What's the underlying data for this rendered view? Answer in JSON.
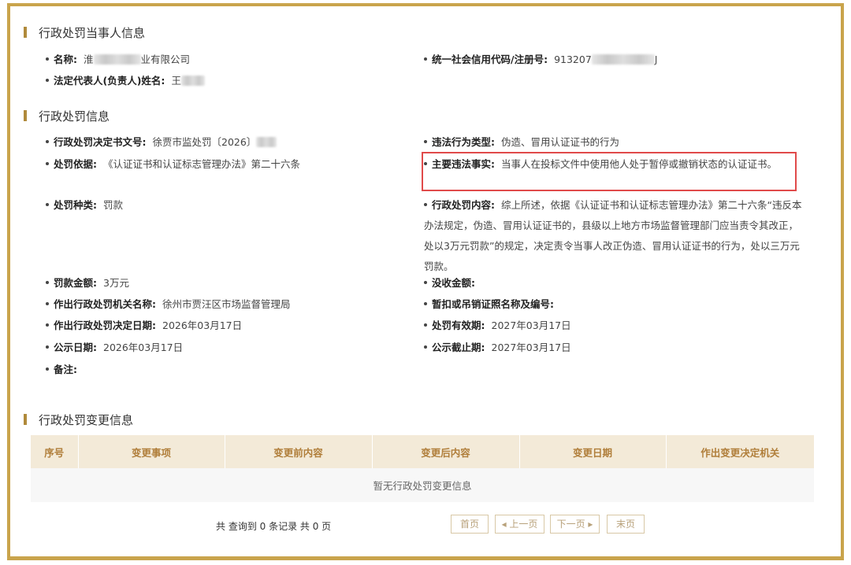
{
  "party_section": {
    "title": "行政处罚当事人信息",
    "name_label": "名称:",
    "name_value_prefix": "淮",
    "name_value_suffix": "业有限公司",
    "credit_code_label": "统一社会信用代码/注册号:",
    "credit_code_prefix": "913207",
    "credit_code_suffix": "J",
    "legal_rep_label": "法定代表人(负责人)姓名:",
    "legal_rep_prefix": "王"
  },
  "penalty_section": {
    "title": "行政处罚信息",
    "doc_no_label": "行政处罚决定书文号:",
    "doc_no_value": "徐贾市监处罚〔2026〕",
    "violation_type_label": "违法行为类型:",
    "violation_type_value": "伪造、冒用认证证书的行为",
    "basis_label": "处罚依据:",
    "basis_value": "《认证证书和认证标志管理办法》第二十六条",
    "main_facts_label": "主要违法事实:",
    "main_facts_value": "当事人在投标文件中使用他人处于暂停或撤销状态的认证证书。",
    "penalty_type_label": "处罚种类:",
    "penalty_type_value": "罚款",
    "penalty_content_label": "行政处罚内容:",
    "penalty_content_value": "综上所述，依据《认证证书和认证标志管理办法》第二十六条“违反本办法规定，伪造、冒用认证证书的，县级以上地方市场监督管理部门应当责令其改正，处以3万元罚款”的规定，决定责令当事人改正伪造、冒用认证证书的行为，处以三万元罚款。",
    "fine_amount_label": "罚款金额:",
    "fine_amount_value": "3万元",
    "confiscation_label": "没收金额:",
    "confiscation_value": "",
    "authority_label": "作出行政处罚机关名称:",
    "authority_value": "徐州市贾汪区市场监督管理局",
    "license_label": "暂扣或吊销证照名称及编号:",
    "license_value": "",
    "decision_date_label": "作出行政处罚决定日期:",
    "decision_date_value": "2026年03月17日",
    "validity_label": "处罚有效期:",
    "validity_value": "2027年03月17日",
    "publish_date_label": "公示日期:",
    "publish_date_value": "2026年03月17日",
    "publish_end_label": "公示截止期:",
    "publish_end_value": "2027年03月17日",
    "remark_label": "备注:",
    "remark_value": ""
  },
  "change_section": {
    "title": "行政处罚变更信息",
    "columns": [
      "序号",
      "变更事项",
      "变更前内容",
      "变更后内容",
      "变更日期",
      "作出变更决定机关"
    ],
    "empty_text": "暂无行政处罚变更信息"
  },
  "pager": {
    "summary": "共 查询到 0 条记录 共 0 页",
    "first": "首页",
    "prev": "◂ 上一页",
    "next": "下一页 ▸",
    "last": "末页"
  },
  "colors": {
    "frame": "#c9a44c",
    "accent": "#b08a3b",
    "header_bg": "#f3ead8",
    "highlight": "#e04a4a"
  }
}
